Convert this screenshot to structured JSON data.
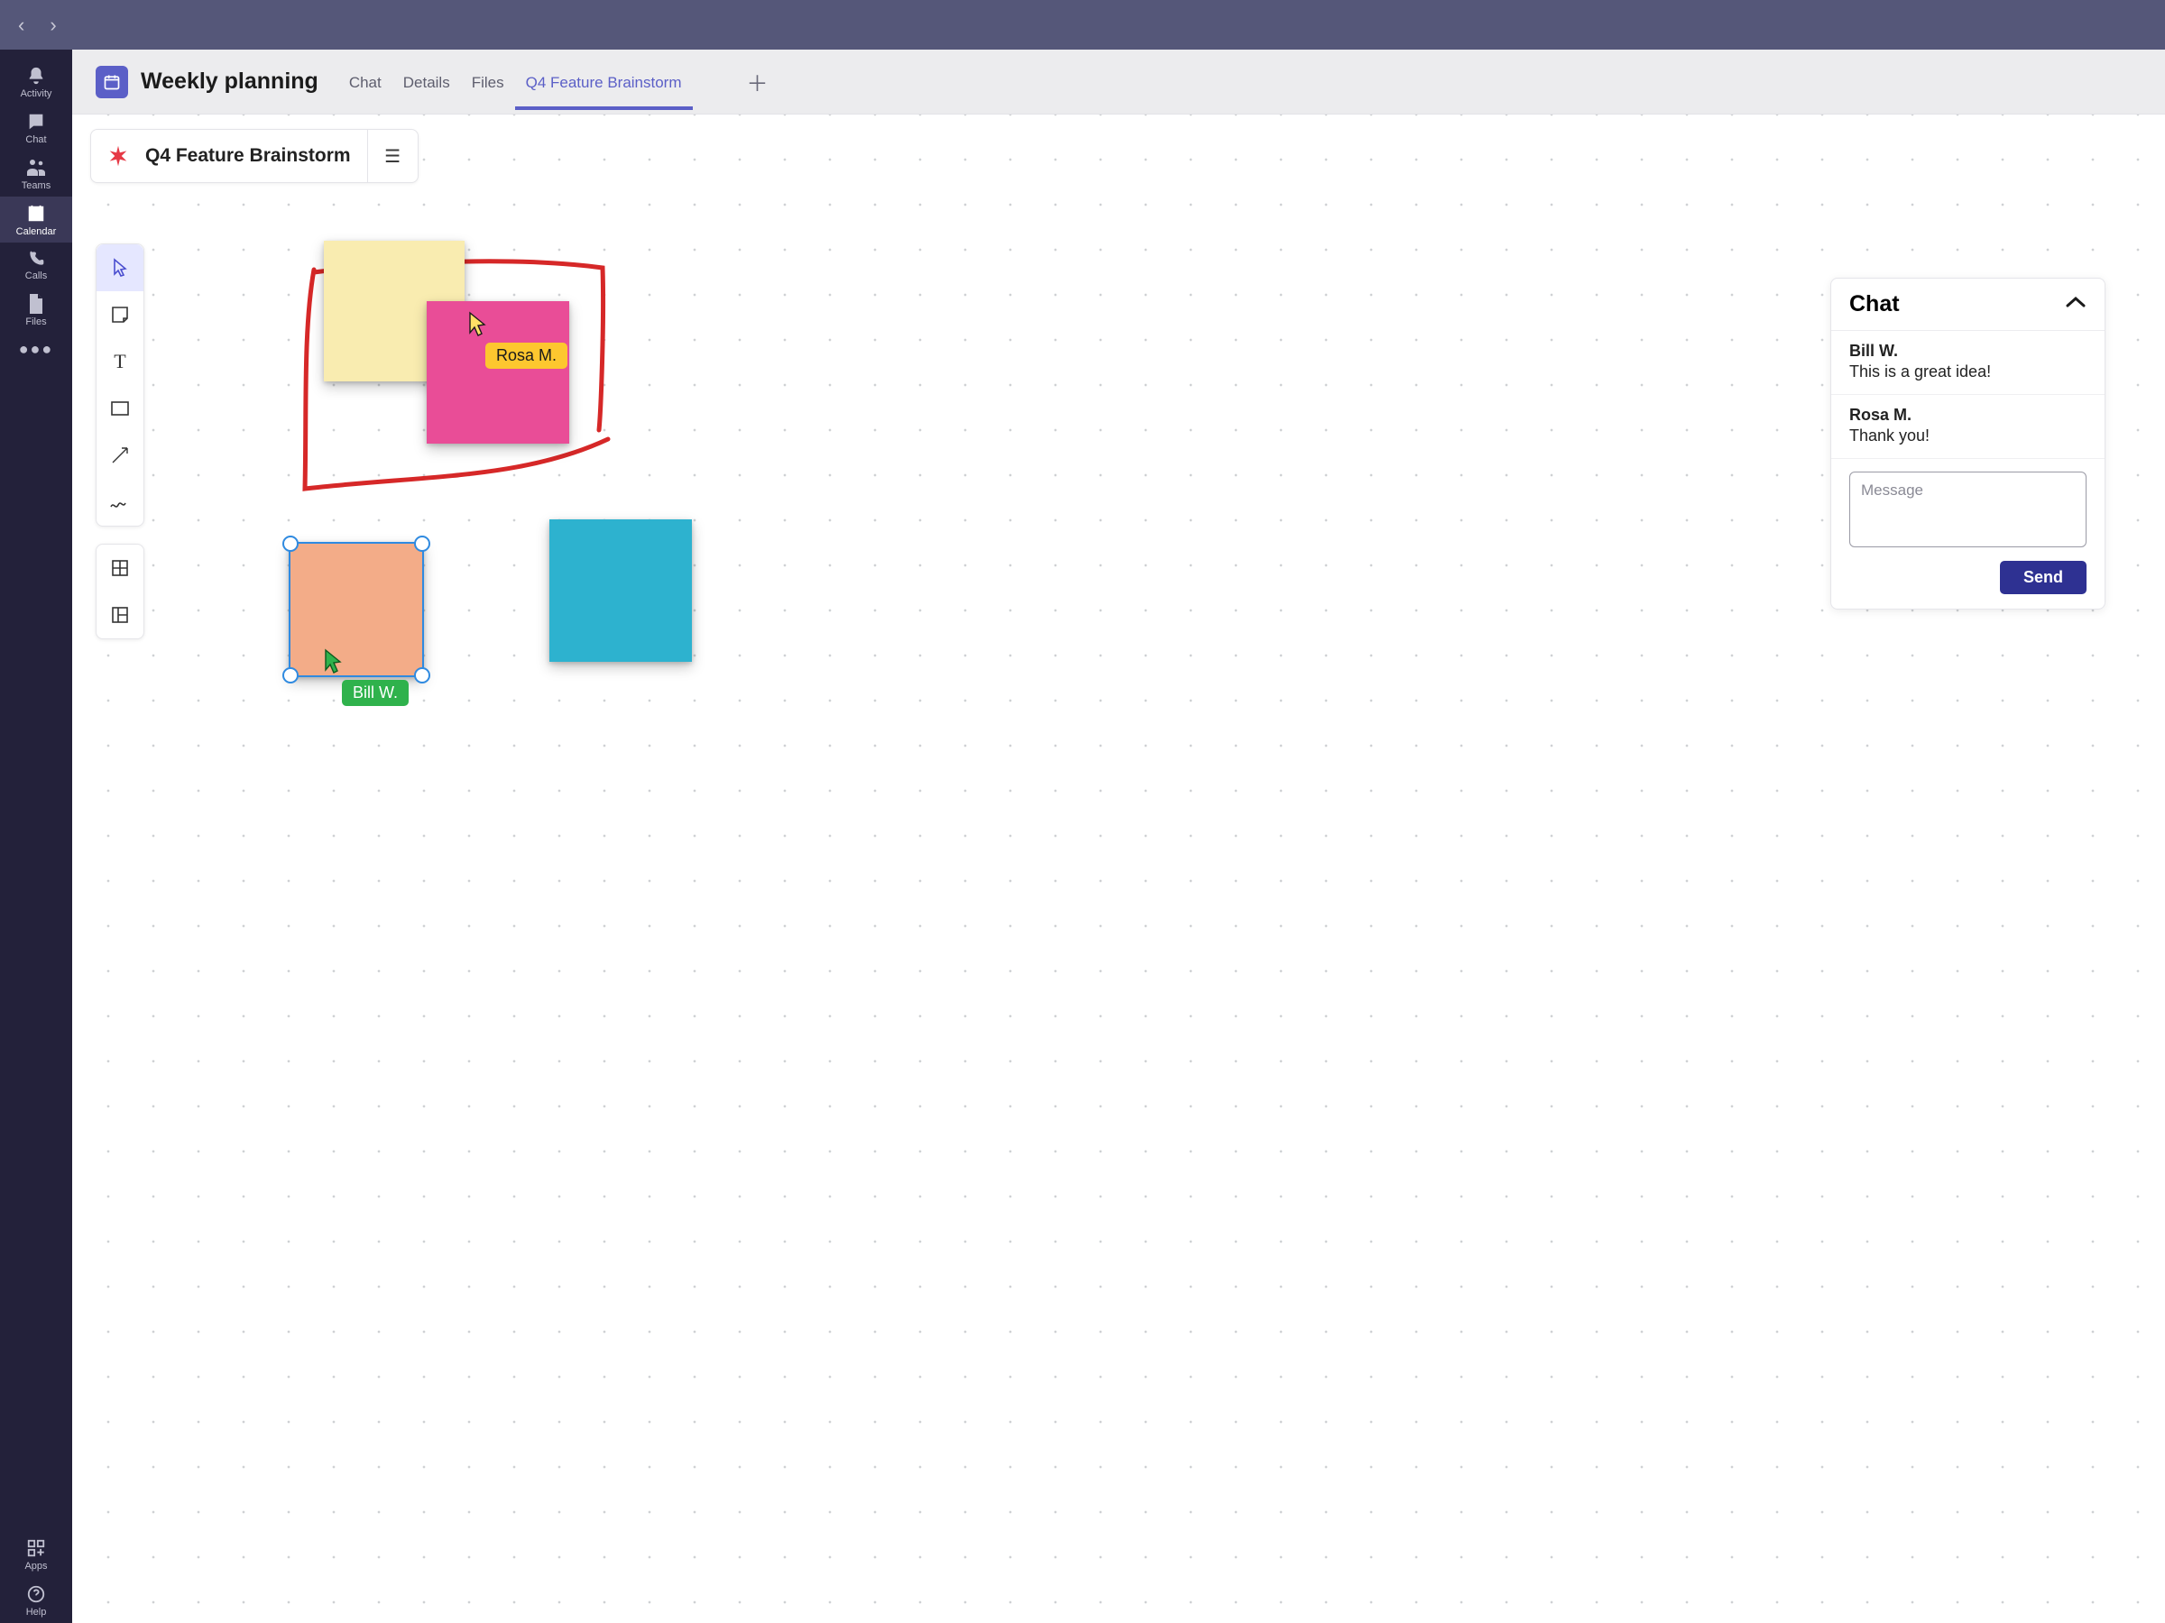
{
  "app_rail": {
    "items": [
      {
        "id": "activity",
        "label": "Activity"
      },
      {
        "id": "chat",
        "label": "Chat"
      },
      {
        "id": "teams",
        "label": "Teams"
      },
      {
        "id": "calendar",
        "label": "Calendar"
      },
      {
        "id": "calls",
        "label": "Calls"
      },
      {
        "id": "files",
        "label": "Files"
      }
    ],
    "more_label": "",
    "bottom": [
      {
        "id": "apps",
        "label": "Apps"
      },
      {
        "id": "help",
        "label": "Help"
      }
    ],
    "active": "calendar"
  },
  "meeting": {
    "title": "Weekly planning",
    "tabs": [
      "Chat",
      "Details",
      "Files",
      "Q4 Feature Brainstorm"
    ],
    "active_tab": "Q4 Feature Brainstorm"
  },
  "board": {
    "title": "Q4 Feature Brainstorm"
  },
  "cursors": {
    "rosa": {
      "name": "Rosa M.",
      "color": "#fdc72f"
    },
    "bill": {
      "name": "Bill W.",
      "color": "#2fb24c"
    }
  },
  "chat_panel": {
    "title": "Chat",
    "messages": [
      {
        "author": "Bill W.",
        "text": "This is a great idea!"
      },
      {
        "author": "Rosa M.",
        "text": "Thank you!"
      }
    ],
    "placeholder": "Message",
    "send_label": "Send"
  }
}
